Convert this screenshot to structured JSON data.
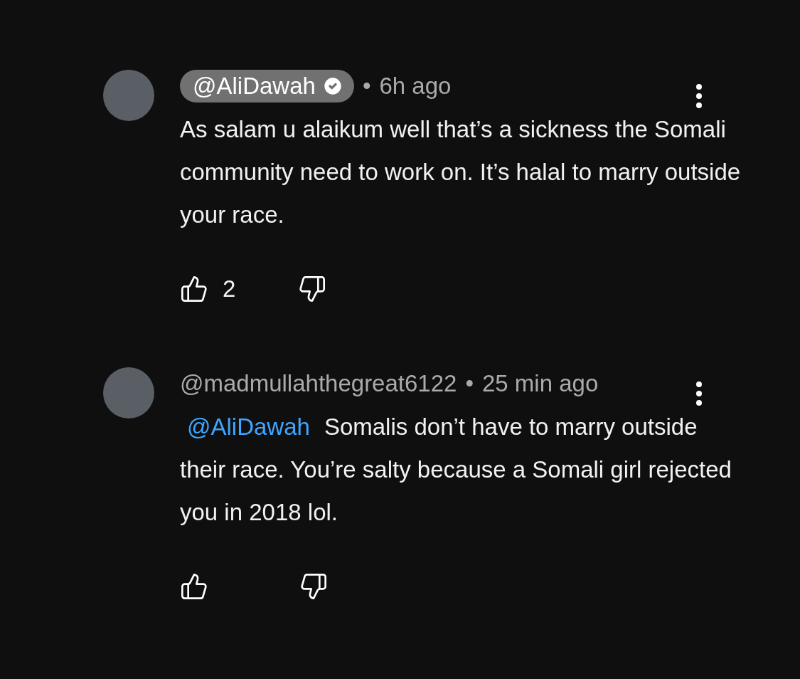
{
  "comments": [
    {
      "author": "@AliDawah",
      "verified": true,
      "highlighted": true,
      "dot": "•",
      "time": "6h ago",
      "text": "As salam u alaikum well that’s a sickness the Somali community need to work on. It’s halal to marry outside your race.",
      "likes": "2"
    },
    {
      "author": "@madmullahthegreat6122",
      "verified": false,
      "highlighted": false,
      "dot": "•",
      "time": "25 min ago",
      "mention": "@AliDawah",
      "text": "Somalis don’t have to marry outside their race. You’re salty because a Somali girl rejected you in 2018 lol."
    }
  ]
}
